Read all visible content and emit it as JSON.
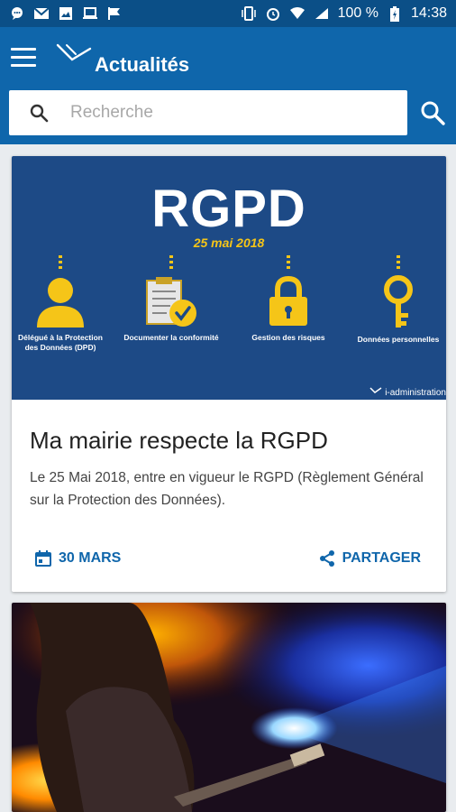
{
  "status_bar": {
    "battery": "100 %",
    "time": "14:38"
  },
  "app_bar": {
    "title": "Actualités"
  },
  "search": {
    "placeholder": "Recherche"
  },
  "cards": [
    {
      "banner": {
        "heading": "RGPD",
        "date": "25 mai 2018",
        "pillars": [
          {
            "label": "Délégué à la Protection des Données (DPD)",
            "icon": "person-icon"
          },
          {
            "label": "Documenter la conformité",
            "icon": "clipboard-check-icon"
          },
          {
            "label": "Gestion des risques",
            "icon": "padlock-icon"
          },
          {
            "label": "Données personnelles",
            "icon": "key-icon"
          }
        ],
        "brand": "i-administration"
      },
      "title": "Ma mairie respecte la RGPD",
      "description": "Le 25 Mai 2018, entre en vigueur le RGPD (Règlement Général sur la Protection des Données).",
      "date_label": "30 MARS",
      "share_label": "PARTAGER"
    },
    {
      "image": "concert-guitarist-photo"
    }
  ],
  "colors": {
    "status_bar": "#0b4f87",
    "app_bar": "#0f66ab",
    "accent": "#0f66ab",
    "banner": "#1d4a86",
    "highlight": "#f5c518"
  }
}
